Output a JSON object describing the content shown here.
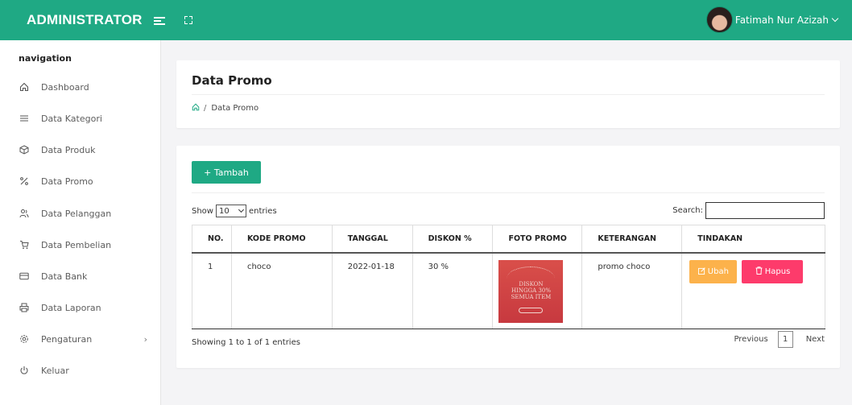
{
  "brand": "ADMINISTRATOR",
  "user": {
    "name": "Fatimah Nur Azizah"
  },
  "nav": {
    "title": "navigation",
    "items": [
      {
        "label": "Dashboard",
        "icon": "home-icon"
      },
      {
        "label": "Data Kategori",
        "icon": "list-icon"
      },
      {
        "label": "Data Produk",
        "icon": "box-icon"
      },
      {
        "label": "Data Promo",
        "icon": "percent-icon"
      },
      {
        "label": "Data Pelanggan",
        "icon": "users-icon"
      },
      {
        "label": "Data Pembelian",
        "icon": "cart-icon"
      },
      {
        "label": "Data Bank",
        "icon": "card-icon"
      },
      {
        "label": "Data Laporan",
        "icon": "printer-icon"
      },
      {
        "label": "Pengaturan",
        "icon": "gear-icon"
      },
      {
        "label": "Keluar",
        "icon": "power-icon"
      }
    ]
  },
  "page": {
    "title": "Data Promo",
    "breadcrumb_sep": "/",
    "breadcrumb": "Data Promo"
  },
  "toolbar": {
    "add_label": "+ Tambah"
  },
  "table_controls": {
    "show_prefix": "Show",
    "entries_value": "10",
    "show_suffix": "entries",
    "search_label": "Search:"
  },
  "table": {
    "headers": [
      "NO.",
      "KODE PROMO",
      "TANGGAL",
      "DISKON %",
      "FOTO PROMO",
      "KETERANGAN",
      "TINDAKAN"
    ],
    "rows": [
      {
        "no": "1",
        "kode": "choco",
        "tanggal": "2022-01-18",
        "diskon": "30 %",
        "foto_text": "DISKON\nHINGGA 30%\nSEMUA ITEM",
        "keterangan": "promo choco",
        "ubah": "Ubah",
        "hapus": "Hapus"
      }
    ]
  },
  "footer": {
    "info": "Showing 1 to 1 of 1 entries",
    "previous": "Previous",
    "page": "1",
    "next": "Next"
  },
  "colors": {
    "primary": "#1fa984",
    "warning": "#fcb24b",
    "danger": "#fd3b6b"
  }
}
